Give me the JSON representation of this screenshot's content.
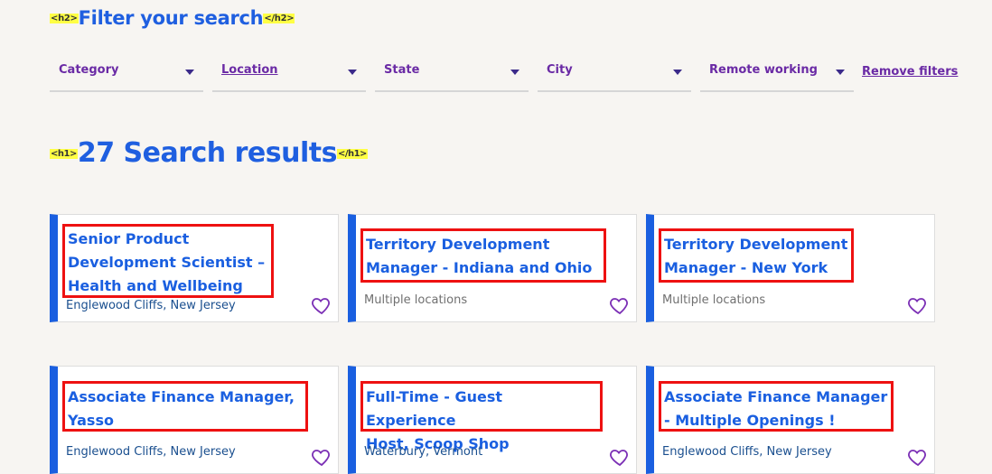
{
  "filters_heading": {
    "open_tag": "<h2>",
    "text": "Filter your search",
    "close_tag": "</h2>"
  },
  "filters": [
    {
      "label": "Category"
    },
    {
      "label": "Location"
    },
    {
      "label": "State"
    },
    {
      "label": "City"
    },
    {
      "label": "Remote working"
    }
  ],
  "remove_filters": "Remove filters",
  "results_heading": {
    "open_tag": "<h1>",
    "text": "27 Search results",
    "close_tag": "</h1>"
  },
  "jobs": [
    {
      "title_lines": [
        "Senior Product",
        "Development Scientist –",
        "Health and Wellbeing"
      ],
      "location": "Englewood Cliffs, New Jersey"
    },
    {
      "title_lines": [
        "Territory Development",
        "Manager - Indiana and Ohio"
      ],
      "location": "Multiple locations"
    },
    {
      "title_lines": [
        "Territory Development",
        "Manager - New York"
      ],
      "location": "Multiple locations"
    },
    {
      "title_lines": [
        "Associate Finance Manager,",
        "Yasso"
      ],
      "location": "Englewood Cliffs, New Jersey"
    },
    {
      "title_lines": [
        "Full-Time - Guest Experience",
        "Host, Scoop Shop"
      ],
      "location": "Waterbury, Vermont"
    },
    {
      "title_lines": [
        "Associate Finance Manager",
        "- Multiple Openings !"
      ],
      "location": "Englewood Cliffs, New Jersey"
    }
  ],
  "colors": {
    "accent": "#1a5fe0",
    "highlight": "#ffff44",
    "box": "#ee1111",
    "filter_text": "#6a2aa5"
  },
  "icons": {
    "favorite": "heart-outline-icon",
    "dropdown": "chevron-down-icon"
  }
}
